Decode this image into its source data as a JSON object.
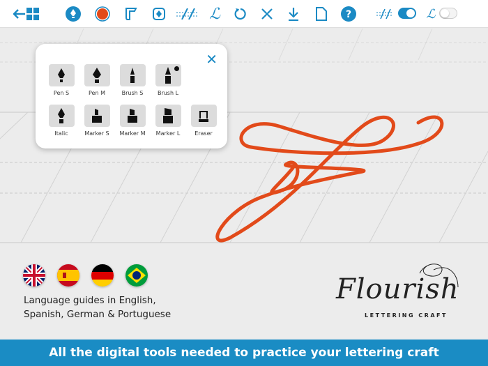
{
  "toolbar": {
    "toggles": {
      "guides_on": true,
      "letter_on": false
    },
    "selected_color": "#e24a1a"
  },
  "tool_popup": {
    "tools": [
      {
        "label": "Pen S",
        "icon": "pen-nib-icon"
      },
      {
        "label": "Pen M",
        "icon": "pen-nib-icon"
      },
      {
        "label": "Brush S",
        "icon": "brush-icon"
      },
      {
        "label": "Brush L",
        "icon": "brush-icon",
        "selected": true
      },
      {
        "label": "Italic",
        "icon": "italic-nib-icon"
      },
      {
        "label": "Marker S",
        "icon": "marker-icon"
      },
      {
        "label": "Marker M",
        "icon": "marker-icon"
      },
      {
        "label": "Marker L",
        "icon": "marker-icon"
      },
      {
        "label": "Eraser",
        "icon": "eraser-icon"
      }
    ]
  },
  "promo": {
    "languages_line1": "Language guides in English,",
    "languages_line2": "Spanish, German & Portuguese",
    "logo_text": "Flourish",
    "logo_sub": "LETTERING CRAFT",
    "banner": "All the digital tools needed to practice your lettering craft"
  },
  "colors": {
    "accent": "#1b8ac4",
    "stroke": "#e24a1a"
  }
}
